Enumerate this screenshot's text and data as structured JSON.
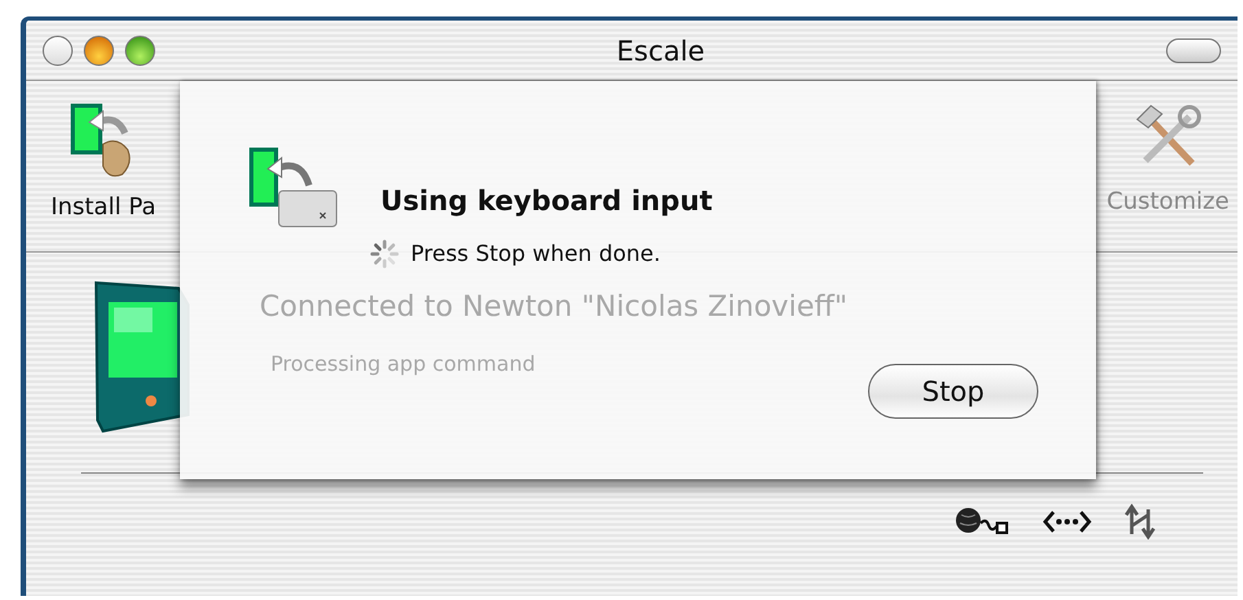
{
  "window": {
    "title": "Escale"
  },
  "toolbar": {
    "items": [
      {
        "kind": "install",
        "label": "Install Pa"
      },
      {
        "kind": "customize",
        "label": "Customize"
      }
    ]
  },
  "main": {
    "status": "Connected to Newton \"Nicolas Zinovieff\"",
    "detail": "Processing app command"
  },
  "sheet": {
    "title": "Using keyboard input",
    "message": "Press Stop when done.",
    "buttons": [
      {
        "label": "Stop"
      }
    ]
  }
}
